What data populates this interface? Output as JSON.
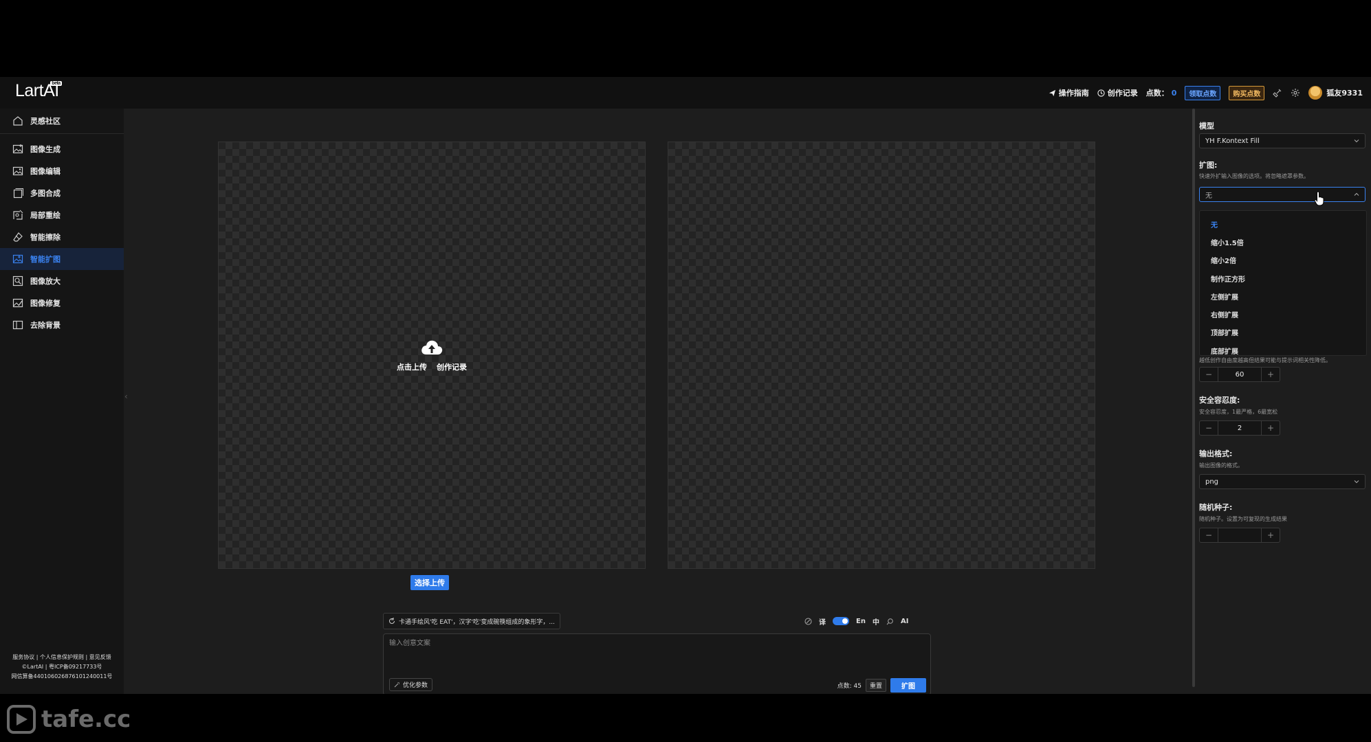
{
  "header": {
    "logo": "LartAI",
    "logo_badge": "beta",
    "guide": "操作指南",
    "history": "创作记录",
    "points_label": "点数：",
    "points_value": "0",
    "get_points": "领取点数",
    "buy_points": "购买点数",
    "username": "狐友9331"
  },
  "sidebar": {
    "community": "灵感社区",
    "items": [
      {
        "label": "图像生成",
        "icon": "image-gen-icon"
      },
      {
        "label": "图像编辑",
        "icon": "image-edit-icon"
      },
      {
        "label": "多图合成",
        "icon": "multi-image-icon"
      },
      {
        "label": "局部重绘",
        "icon": "inpaint-icon"
      },
      {
        "label": "智能擦除",
        "icon": "eraser-icon"
      },
      {
        "label": "智能扩图",
        "icon": "outpaint-icon"
      },
      {
        "label": "图像放大",
        "icon": "zoom-icon"
      },
      {
        "label": "图像修复",
        "icon": "repair-icon"
      },
      {
        "label": "去除背景",
        "icon": "remove-bg-icon"
      }
    ],
    "active_index": 5,
    "footer": {
      "line1": "服务协议 | 个人信息保护规则 | 意见反馈",
      "line2": "©LartAI | 粤ICP备09217733号",
      "line3": "网信算备440106026876101240011号"
    }
  },
  "canvas": {
    "upload": "点击上传",
    "history": "创作记录",
    "select_upload": "选择上传"
  },
  "prompt": {
    "hint": "卡通手绘风'吃 EAT'，汉字'吃'变成碗筷组成的象形字，...",
    "translate": "译",
    "lang_en": "En",
    "lang_zh": "中",
    "ai": "AI",
    "placeholder": "输入创意文案",
    "optimize": "优化参数",
    "cost": "点数: 45",
    "reset": "重置",
    "submit": "扩图"
  },
  "panel": {
    "model_label": "模型",
    "model_value": "YH F.Kontext Fill",
    "expand_label": "扩图:",
    "expand_desc": "快速外扩输入图像的选项。将忽略遮罩参数。",
    "expand_value": "无",
    "expand_options": [
      "无",
      "缩小1.5倍",
      "缩小2倍",
      "制作正方形",
      "左侧扩展",
      "右侧扩展",
      "顶部扩展",
      "底部扩展"
    ],
    "partial_desc": "越低创作自由度越高但结果可能与提示词相关性降低。",
    "steps_value": "60",
    "safety_label": "安全容忍度:",
    "safety_desc": "安全容忍度，1最严格，6最宽松",
    "safety_value": "2",
    "format_label": "输出格式:",
    "format_desc": "输出图像的格式。",
    "format_value": "png",
    "seed_label": "随机种子:",
    "seed_desc": "随机种子。设置为可复现的生成结果",
    "seed_value": ""
  },
  "watermark": "tafe.cc",
  "colors": {
    "accent": "#2f7bea",
    "buy": "#d69a3a",
    "background": "#1d1d1d"
  }
}
